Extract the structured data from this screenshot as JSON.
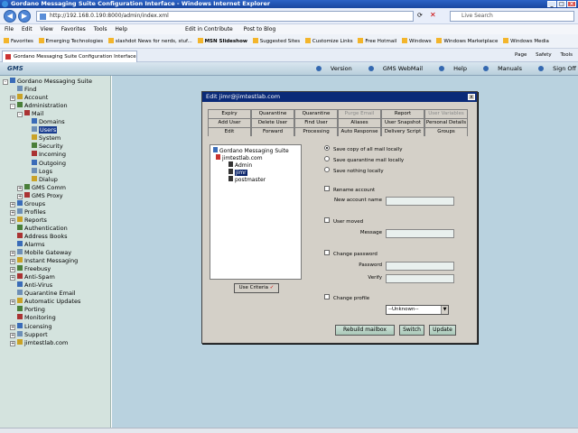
{
  "window": {
    "title": "Gordano Messaging Suite Configuration Interface - Windows Internet Explorer",
    "url": "http://192.168.0.190:8000/admin/index.xml",
    "search_placeholder": "Live Search"
  },
  "menu": [
    "File",
    "Edit",
    "View",
    "Favorites",
    "Tools",
    "Help"
  ],
  "menu_extras": [
    "Edit in Contribute",
    "Post to Blog"
  ],
  "favorites": [
    "Favorites",
    "Emerging Technologies",
    "slashdot News for nerds, stuf...",
    "MSN Slideshow",
    "Suggested Sites",
    "Customize Links",
    "Free Hotmail",
    "Windows",
    "Windows Marketplace",
    "Windows Media"
  ],
  "tab": {
    "label": "Gordano Messaging Suite Configuration Interface"
  },
  "ie_tools": [
    "Page",
    "Safety",
    "Tools"
  ],
  "app": {
    "logo": "GMS",
    "links": [
      "Version",
      "GMS WebMail",
      "Help",
      "Manuals",
      "Sign Off"
    ]
  },
  "sidebar": {
    "items": [
      {
        "label": "Gordano Messaging Suite",
        "indent": 0,
        "toggle": "-"
      },
      {
        "label": "Find",
        "indent": 1,
        "toggle": ""
      },
      {
        "label": "Account",
        "indent": 1,
        "toggle": "+"
      },
      {
        "label": "Administration",
        "indent": 1,
        "toggle": "-"
      },
      {
        "label": "Mail",
        "indent": 2,
        "toggle": "-"
      },
      {
        "label": "Domains",
        "indent": 3,
        "toggle": ""
      },
      {
        "label": "Users",
        "indent": 3,
        "toggle": "",
        "selected": true
      },
      {
        "label": "System",
        "indent": 3,
        "toggle": ""
      },
      {
        "label": "Security",
        "indent": 3,
        "toggle": ""
      },
      {
        "label": "Incoming",
        "indent": 3,
        "toggle": ""
      },
      {
        "label": "Outgoing",
        "indent": 3,
        "toggle": ""
      },
      {
        "label": "Logs",
        "indent": 3,
        "toggle": ""
      },
      {
        "label": "Dialup",
        "indent": 3,
        "toggle": ""
      },
      {
        "label": "GMS Comm",
        "indent": 2,
        "toggle": "+"
      },
      {
        "label": "GMS Proxy",
        "indent": 2,
        "toggle": "+"
      },
      {
        "label": "Groups",
        "indent": 1,
        "toggle": "+"
      },
      {
        "label": "Profiles",
        "indent": 1,
        "toggle": "+"
      },
      {
        "label": "Reports",
        "indent": 1,
        "toggle": "+"
      },
      {
        "label": "Authentication",
        "indent": 1,
        "toggle": ""
      },
      {
        "label": "Address Books",
        "indent": 1,
        "toggle": ""
      },
      {
        "label": "Alarms",
        "indent": 1,
        "toggle": ""
      },
      {
        "label": "Mobile Gateway",
        "indent": 1,
        "toggle": "+"
      },
      {
        "label": "Instant Messaging",
        "indent": 1,
        "toggle": "+"
      },
      {
        "label": "Freebusy",
        "indent": 1,
        "toggle": "+"
      },
      {
        "label": "Anti-Spam",
        "indent": 1,
        "toggle": "+"
      },
      {
        "label": "Anti-Virus",
        "indent": 1,
        "toggle": ""
      },
      {
        "label": "Quarantine Email",
        "indent": 1,
        "toggle": ""
      },
      {
        "label": "Automatic Updates",
        "indent": 1,
        "toggle": "+"
      },
      {
        "label": "Porting",
        "indent": 1,
        "toggle": ""
      },
      {
        "label": "Monitoring",
        "indent": 1,
        "toggle": ""
      },
      {
        "label": "Licensing",
        "indent": 1,
        "toggle": "+"
      },
      {
        "label": "Support",
        "indent": 1,
        "toggle": "+"
      },
      {
        "label": "jimtestlab.com",
        "indent": 1,
        "toggle": "+"
      }
    ]
  },
  "dialog": {
    "title": "Edit jimr@jimtestlab.com",
    "close": "x",
    "tabs_row1": [
      {
        "label": "Expiry"
      },
      {
        "label": "Quarantine"
      },
      {
        "label": "Quarantine Email"
      },
      {
        "label": "Purge Email",
        "disabled": true
      },
      {
        "label": "Report"
      },
      {
        "label": "User Variables",
        "disabled": true
      }
    ],
    "tabs_row2": [
      {
        "label": "Add User"
      },
      {
        "label": "Delete User"
      },
      {
        "label": "Find User"
      },
      {
        "label": "Aliases"
      },
      {
        "label": "User Snapshot"
      },
      {
        "label": "Personal Details"
      }
    ],
    "tabs_row3": [
      {
        "label": "Edit"
      },
      {
        "label": "Forward"
      },
      {
        "label": "Processing"
      },
      {
        "label": "Auto Response"
      },
      {
        "label": "Delivery Script"
      },
      {
        "label": "Groups"
      }
    ],
    "tree": {
      "root": "Gordano Messaging Suite",
      "domain": "jimtestlab.com",
      "users": [
        "Admin",
        "jimr",
        "postmaster"
      ]
    },
    "use_criteria": "Use Criteria",
    "radios": [
      {
        "label": "Save copy of all mail locally",
        "checked": true
      },
      {
        "label": "Save quarantine mail locally",
        "checked": false
      },
      {
        "label": "Save nothing locally",
        "checked": false
      }
    ],
    "rename": {
      "label": "Rename account",
      "field_label": "New account name"
    },
    "moved": {
      "label": "User moved",
      "field_label": "Message"
    },
    "password": {
      "label": "Change password",
      "field1": "Password",
      "field2": "Verify"
    },
    "profile": {
      "label": "Change profile",
      "selected": "--Unknown--"
    },
    "buttons": {
      "rebuild": "Rebuild mailbox",
      "switch": "Switch",
      "update": "Update"
    }
  }
}
